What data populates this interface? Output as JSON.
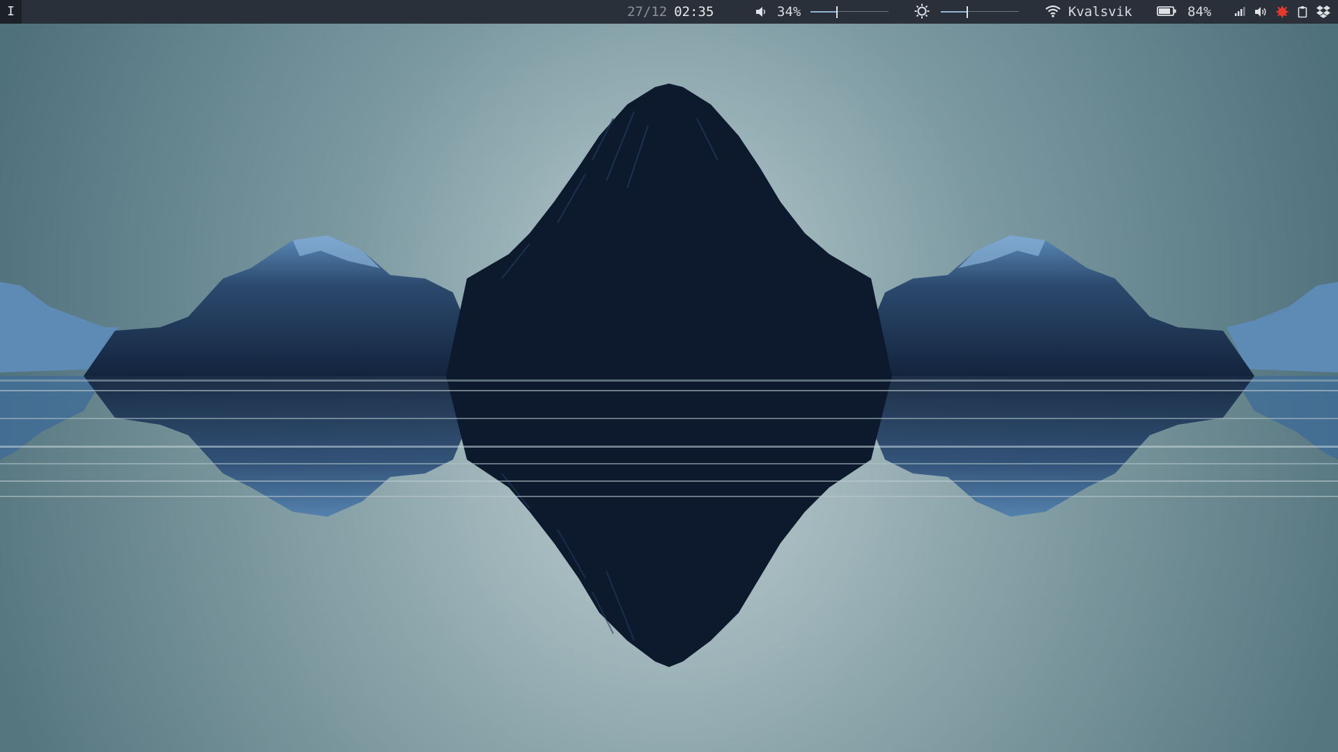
{
  "topbar": {
    "workspace_label": "I",
    "date": "27/12",
    "time": "02:35",
    "volume": {
      "icon": "speaker-icon",
      "percent_label": "34%",
      "level": 0.34
    },
    "brightness": {
      "icon": "sun-icon",
      "level": 0.34
    },
    "network": {
      "icon": "wifi-icon",
      "ssid": "Kvalsvik"
    },
    "battery": {
      "icon": "battery-icon",
      "percent_label": "84%",
      "level": 0.84
    },
    "tray": [
      {
        "name": "signal-bars-icon"
      },
      {
        "name": "volume-tray-icon"
      },
      {
        "name": "red-gear-icon",
        "color": "#e23b2e"
      },
      {
        "name": "clipboard-icon"
      },
      {
        "name": "dropbox-icon"
      }
    ]
  },
  "colors": {
    "bar_bg": "#2a3039",
    "sky_light": "#b4c8ce",
    "sky_dark": "#557782",
    "mountain_dark": "#0d1a2e",
    "mountain_light": "#4a78a8",
    "accent": "#8fb4d6"
  }
}
